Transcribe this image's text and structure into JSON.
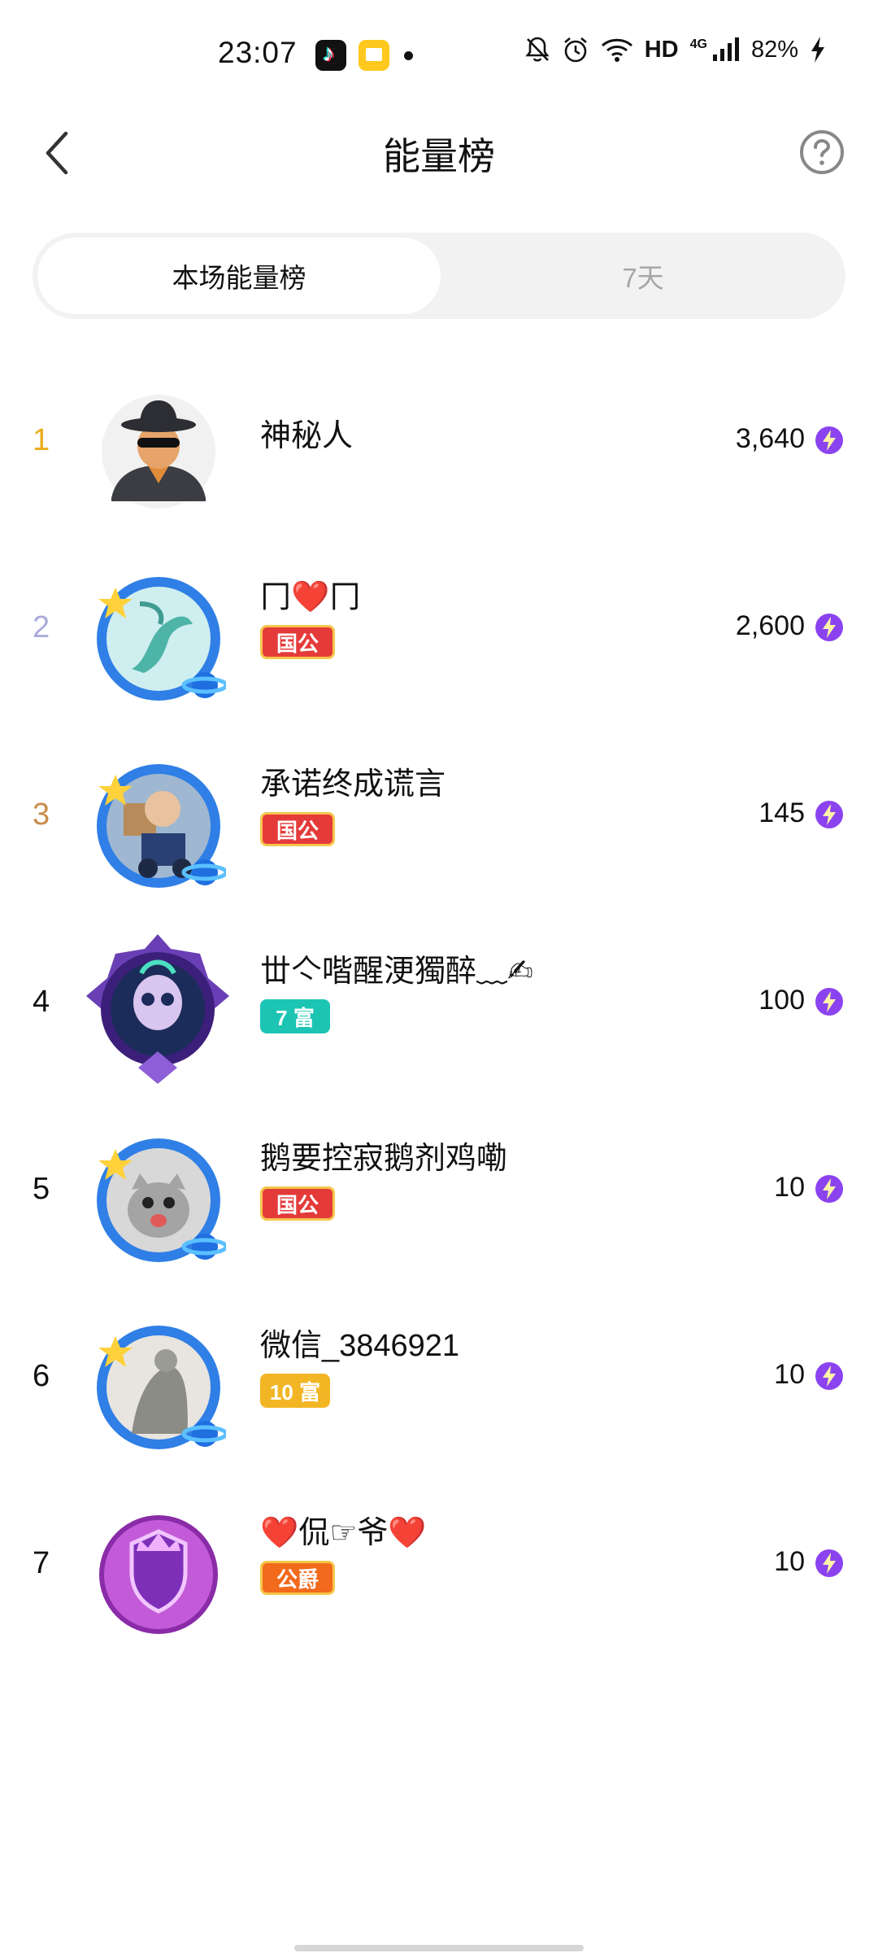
{
  "status_bar": {
    "time": "23:07",
    "network_type": "HD",
    "network_gen": "4G",
    "battery": "82%",
    "icons": [
      "tiktok-app-icon",
      "reader-app-icon",
      "notification-dot",
      "bell-muted-icon",
      "alarm-icon",
      "wifi-icon",
      "signal-icon",
      "charging-icon"
    ]
  },
  "header": {
    "title": "能量榜",
    "back_icon": "chevron-left-icon",
    "help_icon": "question-circle-icon"
  },
  "tabs": [
    {
      "label": "本场能量榜",
      "active": true
    },
    {
      "label": "7天",
      "active": false
    }
  ],
  "colors": {
    "rank_1": "#e9ac1b",
    "rank_2": "#a9abd9",
    "rank_3": "#c98c4c",
    "badge_red": "#e53a3a",
    "badge_teal": "#1cc4b4",
    "badge_gold": "#f2b625",
    "badge_orange": "#f26a1c",
    "energy_purple": "#8b43f0"
  },
  "rank_list": [
    {
      "rank": "1",
      "name": "神秘人",
      "badge": "",
      "score": "3,640"
    },
    {
      "rank": "2",
      "name": "冂❤️冂",
      "badge": "国公",
      "score": "2,600"
    },
    {
      "rank": "3",
      "name": "承诺终成谎言",
      "badge": "国公",
      "score": "145"
    },
    {
      "rank": "4",
      "name": "丗亽喈醒浭獨醉﹏✍",
      "badge": "7 富",
      "score": "100"
    },
    {
      "rank": "5",
      "name": "鹅要控寂鹅剂鸡嘞",
      "badge": "国公",
      "score": "10"
    },
    {
      "rank": "6",
      "name": "微信_3846921",
      "badge": "10 富",
      "score": "10"
    },
    {
      "rank": "7",
      "name": "❤️侃☞爷❤️",
      "badge": "公爵",
      "score": "10"
    }
  ],
  "score_icon": "lightning-energy-icon"
}
